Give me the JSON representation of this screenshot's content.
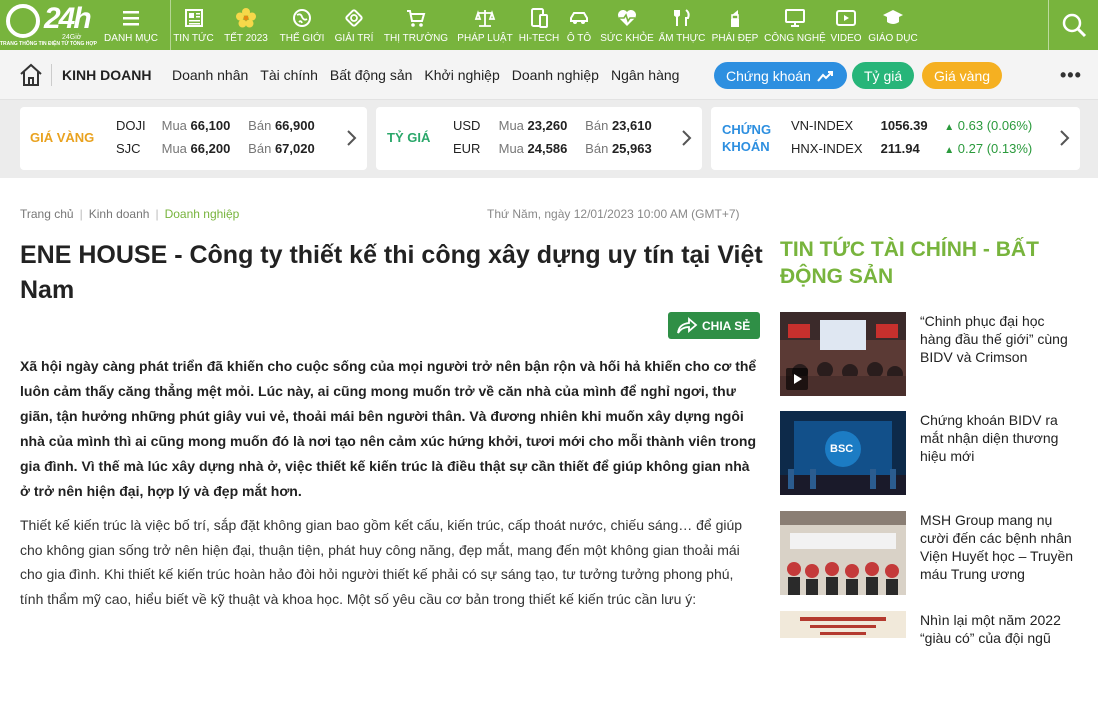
{
  "brand": {
    "logo_text": "24h",
    "logo_sub": "24Giờ",
    "tagline": "TRANG THÔNG TIN ĐIỆN TỬ TỔNG HỢP"
  },
  "nav": [
    {
      "label": "DANH MỤC",
      "icon": "menu-icon"
    },
    {
      "label": "TIN TỨC",
      "icon": "newspaper-icon"
    },
    {
      "label": "TẾT 2023",
      "icon": "apricot-flower-icon"
    },
    {
      "label": "THẾ GIỚI",
      "icon": "globe-icon"
    },
    {
      "label": "GIẢI TRÍ",
      "icon": "film-ticket-icon"
    },
    {
      "label": "THỊ TRƯỜNG",
      "icon": "cart-icon"
    },
    {
      "label": "PHÁP LUẬT",
      "icon": "scales-icon"
    },
    {
      "label": "HI-TECH",
      "icon": "devices-icon"
    },
    {
      "label": "Ô TÔ",
      "icon": "car-icon"
    },
    {
      "label": "SỨC KHỎE",
      "icon": "heartbeat-icon"
    },
    {
      "label": "ẨM THỰC",
      "icon": "cutlery-icon"
    },
    {
      "label": "PHÁI ĐẸP",
      "icon": "lipstick-icon"
    },
    {
      "label": "CÔNG NGHỆ",
      "icon": "monitor-icon"
    },
    {
      "label": "VIDEO",
      "icon": "video-icon"
    },
    {
      "label": "GIÁO DỤC",
      "icon": "graduation-cap-icon"
    }
  ],
  "subnav": {
    "section": "KINH DOANH",
    "links": [
      "Doanh nhân",
      "Tài chính",
      "Bất động sản",
      "Khởi nghiệp",
      "Doanh nghiệp",
      "Ngân hàng"
    ],
    "pills": {
      "stock": "Chứng khoán",
      "rate": "Tỷ giá",
      "gold": "Giá vàng"
    }
  },
  "ticker": {
    "gold": {
      "label": "GIÁ VÀNG",
      "rows": [
        {
          "name": "DOJI",
          "buy_label": "Mua",
          "buy": "66,100",
          "sell_label": "Bán",
          "sell": "66,900"
        },
        {
          "name": "SJC",
          "buy_label": "Mua",
          "buy": "66,200",
          "sell_label": "Bán",
          "sell": "67,020"
        }
      ]
    },
    "rate": {
      "label": "TỶ GIÁ",
      "rows": [
        {
          "name": "USD",
          "buy_label": "Mua",
          "buy": "23,260",
          "sell_label": "Bán",
          "sell": "23,610"
        },
        {
          "name": "EUR",
          "buy_label": "Mua",
          "buy": "24,586",
          "sell_label": "Bán",
          "sell": "25,963"
        }
      ]
    },
    "stock": {
      "label_line1": "CHỨNG",
      "label_line2": "KHOÁN",
      "rows": [
        {
          "name": "VN-INDEX",
          "value": "1056.39",
          "change": "0.63 (0.06%)"
        },
        {
          "name": "HNX-INDEX",
          "value": "211.94",
          "change": "0.27 (0.13%)"
        }
      ]
    }
  },
  "article": {
    "breadcrumb": [
      "Trang chủ",
      "Kinh doanh",
      "Doanh nghiệp"
    ],
    "datetime": "Thứ Năm, ngày 12/01/2023 10:00 AM (GMT+7)",
    "title": "ENE HOUSE - Công ty thiết kế thi công xây dựng uy tín tại Việt Nam",
    "share_label": "CHIA SẺ",
    "lead": "Xã hội ngày càng phát triển đã khiến cho cuộc sống của mọi người trở nên bận rộn và hối hả khiến cho cơ thể luôn cảm thấy căng thẳng mệt mỏi. Lúc này, ai cũng mong muốn trở về căn nhà của mình để nghỉ ngơi, thư giãn, tận hưởng những phút giây vui vẻ, thoải mái bên người thân. Và đương nhiên khi muốn xây dựng ngôi nhà của mình thì ai cũng mong muốn đó là nơi tạo nên cảm xúc hứng khởi, tươi mới cho mỗi thành viên trong gia đình. Vì thế mà lúc xây dựng nhà ở, việc thiết kế kiến trúc là điều thật sự cần thiết để giúp không gian nhà ở trở nên hiện đại, hợp lý và đẹp mắt hơn.",
    "body": "Thiết kế kiến trúc là việc bố trí, sắp đặt không gian bao gồm kết cấu, kiến trúc, cấp thoát nước, chiếu sáng… để giúp cho không gian sống trở nên hiện đại, thuận tiện, phát huy công năng, đẹp mắt, mang đến một không gian thoải mái cho gia đình. Khi thiết kế kiến trúc hoàn hảo đòi hỏi người thiết kế phải có sự sáng tạo, tư tưởng tưởng phong phú, tính thẩm mỹ cao, hiểu biết về kỹ thuật và khoa học. Một số yêu cầu cơ bản trong thiết kế kiến trúc cần lưu ý:"
  },
  "sidebar": {
    "title": "TIN TỨC TÀI CHÍNH - BẤT ĐỘNG SẢN",
    "items": [
      {
        "title": "“Chinh phục đại học hàng đầu thế giới” cùng BIDV và Crimson"
      },
      {
        "title": "Chứng khoán BIDV ra mắt nhận diện thương hiệu mới",
        "thumb_text": "BSC"
      },
      {
        "title": "MSH Group mang nụ cười đến các bệnh nhân Viện Huyết học – Truyền máu Trung ương"
      },
      {
        "title": "Nhìn lại một năm 2022 “giàu có” của đội ngũ"
      }
    ]
  },
  "colors": {
    "brand_green": "#78b43d",
    "stock_blue": "#2d8fe0",
    "rate_green": "#27b579",
    "gold_orange": "#f5b021",
    "gold_label": "#e9a21f",
    "share_green": "#2f8f46"
  }
}
